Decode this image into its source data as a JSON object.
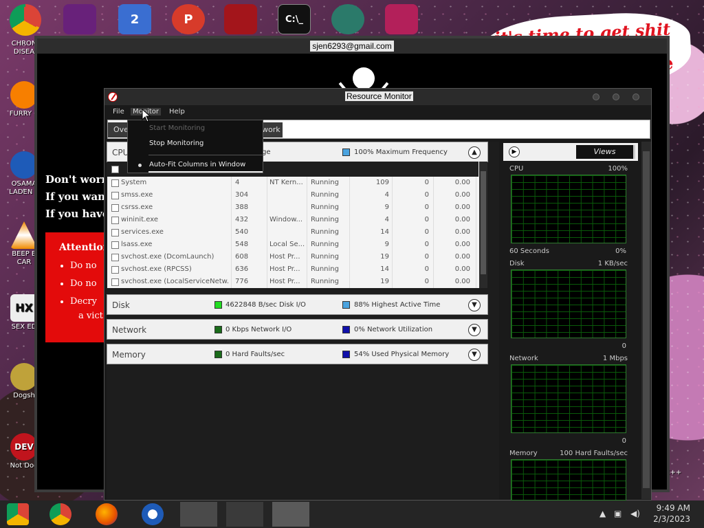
{
  "desktop": {
    "icons": [
      {
        "label": "CHRON\nDISEA",
        "color": "#db4437"
      },
      {
        "label": "FURRY C",
        "color": "#f77f00"
      },
      {
        "label": "OSAMA\nLADEN E",
        "color": "#1e5bb8"
      },
      {
        "label": "BEEP B\nCAR",
        "color": "#f08a00"
      },
      {
        "label": "SEX ED",
        "color": "#444"
      },
      {
        "label": "Dogsh",
        "color": "#bfa23a"
      },
      {
        "label": "Not Dog",
        "color": "#c0141d"
      }
    ],
    "top_icons": [
      {
        "name": "chrome-icon",
        "color": "#db4437",
        "glyph": ""
      },
      {
        "name": "visual-studio-icon",
        "color": "#68217a",
        "glyph": ""
      },
      {
        "name": "app-2-icon",
        "color": "#3a6ed1",
        "glyph": "2"
      },
      {
        "name": "p-icon",
        "color": "#d73b2a",
        "glyph": "P"
      },
      {
        "name": "red-logo-icon",
        "color": "#a3151b",
        "glyph": ""
      },
      {
        "name": "cmd-icon",
        "color": "#111",
        "glyph": "C:\\_"
      },
      {
        "name": "pirate-icon",
        "color": "#2b7a6a",
        "glyph": ""
      },
      {
        "name": "video-icon",
        "color": "#b3205a",
        "glyph": ""
      }
    ],
    "sticker_text": "it's time to get shit",
    "sticker_te": "te",
    "right_edge_label": "n C++"
  },
  "ransom_window": {
    "title": "sjen6293@gmail.com",
    "lines": [
      "Don't worry",
      "If you want",
      "If you have"
    ],
    "attention": "Attention",
    "bullets": [
      "Do no",
      "Do no",
      "Decry"
    ],
    "victim": "a vict"
  },
  "resource_monitor": {
    "title": "Resource Monitor",
    "menu": [
      "File",
      "Monitor",
      "Help"
    ],
    "tabs": [
      "Ove",
      "work"
    ],
    "monitor_menu": {
      "items": [
        {
          "label": "Start Monitoring",
          "disabled": true
        },
        {
          "label": "Stop Monitoring",
          "disabled": false
        },
        {
          "label": "Auto-Fit Columns in Window",
          "disabled": false,
          "checked": true
        }
      ]
    },
    "cpu_section": {
      "name": "CPU",
      "stat1": "ge",
      "stat2": "100% Maximum Frequency"
    },
    "processes": [
      {
        "name": "System",
        "pid": "4",
        "desc": "NT Kern...",
        "status": "Running",
        "threads": "109",
        "cpu": "0",
        "avg": "0.00"
      },
      {
        "name": "smss.exe",
        "pid": "304",
        "desc": "",
        "status": "Running",
        "threads": "4",
        "cpu": "0",
        "avg": "0.00"
      },
      {
        "name": "csrss.exe",
        "pid": "388",
        "desc": "",
        "status": "Running",
        "threads": "9",
        "cpu": "0",
        "avg": "0.00"
      },
      {
        "name": "wininit.exe",
        "pid": "432",
        "desc": "Window...",
        "status": "Running",
        "threads": "4",
        "cpu": "0",
        "avg": "0.00"
      },
      {
        "name": "services.exe",
        "pid": "540",
        "desc": "",
        "status": "Running",
        "threads": "14",
        "cpu": "0",
        "avg": "0.00"
      },
      {
        "name": "lsass.exe",
        "pid": "548",
        "desc": "Local Se...",
        "status": "Running",
        "threads": "9",
        "cpu": "0",
        "avg": "0.00"
      },
      {
        "name": "svchost.exe (DcomLaunch)",
        "pid": "608",
        "desc": "Host Pr...",
        "status": "Running",
        "threads": "19",
        "cpu": "0",
        "avg": "0.00"
      },
      {
        "name": "svchost.exe (RPCSS)",
        "pid": "636",
        "desc": "Host Pr...",
        "status": "Running",
        "threads": "14",
        "cpu": "0",
        "avg": "0.00"
      },
      {
        "name": "svchost.exe (LocalServiceNetw...",
        "pid": "776",
        "desc": "Host Pr...",
        "status": "Running",
        "threads": "19",
        "cpu": "0",
        "avg": "0.00"
      }
    ],
    "disk_section": {
      "name": "Disk",
      "stat1": "4622848 B/sec Disk I/O",
      "stat2": "88% Highest Active Time",
      "color1": "#22dd22",
      "color2": "#4aa3df"
    },
    "network_section": {
      "name": "Network",
      "stat1": "0 Kbps Network I/O",
      "stat2": "0% Network Utilization",
      "color1": "#1a6b1a",
      "color2": "#1010aa"
    },
    "memory_section": {
      "name": "Memory",
      "stat1": "0 Hard Faults/sec",
      "stat2": "54% Used Physical Memory",
      "color1": "#1a6b1a",
      "color2": "#1010aa"
    },
    "views_label": "Views",
    "graphs": [
      {
        "label": "CPU",
        "max": "100%",
        "bottom_left": "60 Seconds",
        "bottom_right": "0%"
      },
      {
        "label": "Disk",
        "max": "1 KB/sec",
        "bottom_left": "",
        "bottom_right": "0"
      },
      {
        "label": "Network",
        "max": "1 Mbps",
        "bottom_left": "",
        "bottom_right": "0"
      },
      {
        "label": "Memory",
        "max": "100 Hard Faults/sec",
        "bottom_left": "",
        "bottom_right": ""
      }
    ]
  },
  "taskbar": {
    "time": "9:49 AM",
    "date": "2/3/2023"
  }
}
